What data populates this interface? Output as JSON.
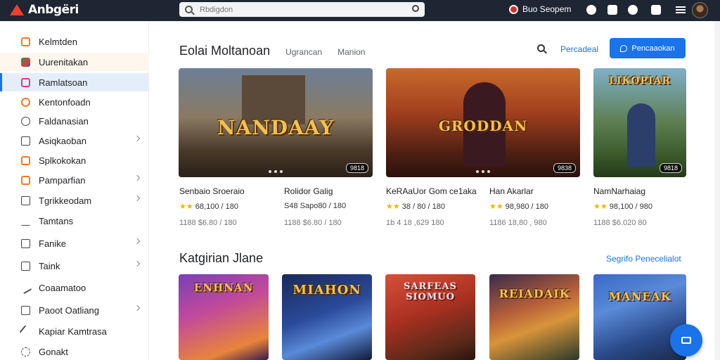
{
  "app": {
    "title": "Anbgëri",
    "brand_color": "#e8412c"
  },
  "topbar": {
    "search_placeholder": "Rbdigdon",
    "user_name": "Buo Seopem",
    "icons": [
      "play-icon",
      "share-icon",
      "flower-icon",
      "bookmark-icon",
      "menu-icon"
    ]
  },
  "sidebar": {
    "items": [
      {
        "label": "Kelmtden",
        "icon": "home-icon",
        "has_chevron": false
      },
      {
        "label": "Uurenitakan",
        "icon": "game-icon",
        "has_chevron": false
      },
      {
        "label": "Ramlatsoan",
        "icon": "library-icon",
        "has_chevron": false
      },
      {
        "label": "Kentonfoadn",
        "icon": "refresh-icon",
        "has_chevron": false
      },
      {
        "label": "Faldanasian",
        "icon": "compass-icon",
        "has_chevron": false
      },
      {
        "label": "Asiqkaoban",
        "icon": "lock-icon",
        "has_chevron": true
      },
      {
        "label": "Splkokokan",
        "icon": "box-icon",
        "has_chevron": false
      },
      {
        "label": "Pamparfian",
        "icon": "doc-icon",
        "has_chevron": true
      },
      {
        "label": "Tgrikkeodam",
        "icon": "list-icon",
        "has_chevron": true
      },
      {
        "label": "Tamtans",
        "icon": "tag-icon",
        "has_chevron": false
      },
      {
        "label": "Fanike",
        "icon": "folder-icon",
        "has_chevron": true
      },
      {
        "label": "Taink",
        "icon": "file-icon",
        "has_chevron": true
      },
      {
        "label": "Coaamatoo",
        "icon": "tool-icon",
        "has_chevron": false
      },
      {
        "label": "Paoot Oatliang",
        "icon": "monitor-icon",
        "has_chevron": true
      },
      {
        "label": "Kapiar Kamtrasa",
        "icon": "pen-icon",
        "has_chevron": false
      },
      {
        "label": "Gonakt",
        "icon": "gear-icon",
        "has_chevron": false
      }
    ],
    "active_index": 2
  },
  "main": {
    "title": "Eolai Moltanoan",
    "tabs": [
      "Ugrancan",
      "Manion"
    ],
    "link": "Percadeal",
    "primary_button": "Pencaaokan",
    "featured": [
      {
        "art_title": "NANDAAY",
        "badge": "9818",
        "title": "Senbaio Sroeraio",
        "rating": "68,100 / 180",
        "stars": 2,
        "meta": "1188 $6.80 / 180"
      },
      {
        "art_title": "",
        "badge": "",
        "title": "Rolidor Galig",
        "rating": "S48 Sapo80 / 180",
        "stars": 0,
        "meta": "1188 $6.80 / 180"
      },
      {
        "art_title": "GRODDAN",
        "badge": "9838",
        "title": "KeRAaUor Gom ce1aka",
        "rating": "38 / 80 / 180",
        "stars": 2,
        "meta": "1b 4 18 ,629 180"
      },
      {
        "art_title": "",
        "badge": "",
        "title": "Han Akarlar",
        "rating": "98,980 / 180",
        "stars": 2,
        "meta": "1186 18,80 , 980"
      },
      {
        "art_title": "LIKOPIAR",
        "badge": "9818",
        "title": "NamNarhaiag",
        "rating": "98,100 / 980",
        "stars": 2,
        "meta": "1188 $6.020 80"
      }
    ],
    "section_title": "Katgirian Jlane",
    "section_link": "Segrifo Penecelialot",
    "category_cards": [
      {
        "art_title": "ENHNAN"
      },
      {
        "art_title": "MIAHON"
      },
      {
        "art_title": "SARFEAS SIOMUO"
      },
      {
        "art_title": "REIADAIK"
      },
      {
        "art_title": "MANEAK"
      }
    ]
  }
}
